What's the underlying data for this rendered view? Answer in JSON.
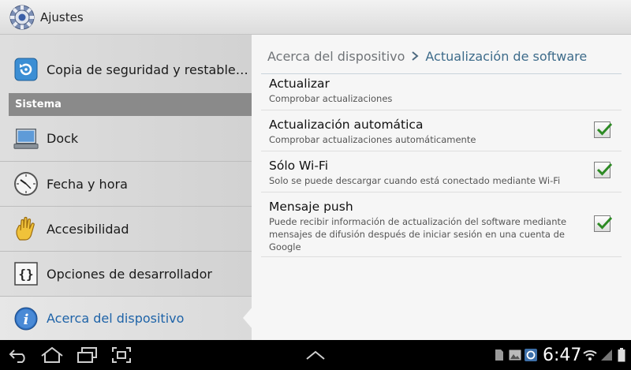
{
  "app": {
    "title": "Ajustes",
    "icon": "settings-gear-icon"
  },
  "sidebar": {
    "items_top": [
      {
        "label": "Copia de seguridad y restable…",
        "icon": "backup-restore-icon"
      }
    ],
    "section_header": "Sistema",
    "items": [
      {
        "label": "Dock",
        "icon": "dock-icon"
      },
      {
        "label": "Fecha y hora",
        "icon": "clock-icon"
      },
      {
        "label": "Accesibilidad",
        "icon": "hand-icon"
      },
      {
        "label": "Opciones de desarrollador",
        "icon": "braces-icon"
      },
      {
        "label": "Acerca del dispositivo",
        "icon": "info-icon",
        "active": true
      }
    ]
  },
  "main": {
    "breadcrumb": {
      "parent": "Acerca del dispositivo",
      "separator": ">",
      "current": "Actualización de software"
    },
    "prefs": [
      {
        "title": "Actualizar",
        "summary": "Comprobar actualizaciones"
      },
      {
        "title": "Actualización automática",
        "summary": "Comprobar actualizaciones automáticamente",
        "checked": true
      },
      {
        "title": "Sólo Wi-Fi",
        "summary": "Solo se puede descargar cuando está conectado mediante Wi-Fi",
        "checked": true
      },
      {
        "title": "Mensaje push",
        "summary_lines": [
          "Puede recibir información de actualización del software mediante",
          "mensajes de difusión después de iniciar sesión en una cuenta de",
          "Google"
        ],
        "checked": true
      }
    ]
  },
  "system_bar": {
    "time": "6:47",
    "buttons": [
      "back-icon",
      "home-icon",
      "recent-apps-icon",
      "screenshot-icon",
      "expand-up-icon"
    ],
    "status_icons": [
      "sd-card-icon",
      "gallery-icon",
      "sync-icon",
      "wifi-icon",
      "signal-icon",
      "battery-icon"
    ]
  },
  "colors": {
    "accent": "#1e63a8",
    "check": "#2d8a24",
    "section": "#8a8a8a"
  }
}
